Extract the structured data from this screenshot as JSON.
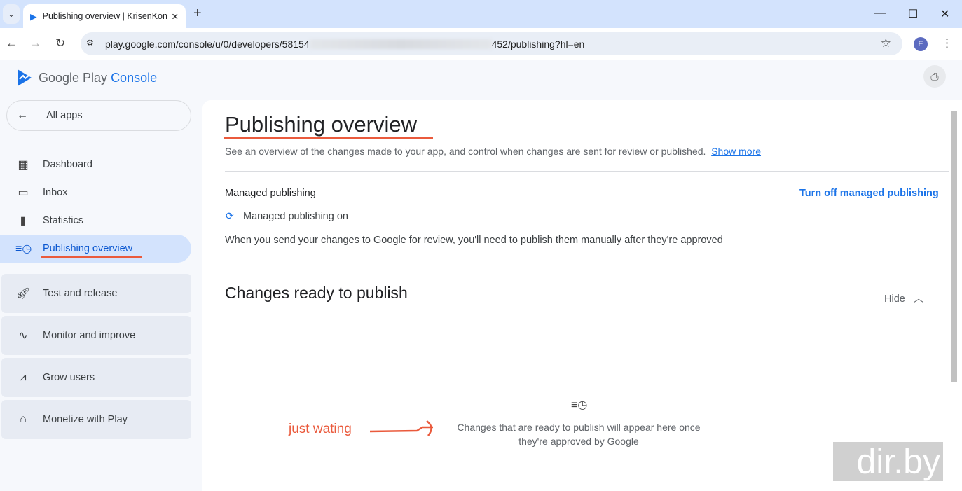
{
  "browser": {
    "tab_title": "Publishing overview | KrisenKon",
    "url_prefix": "play.google.com/console/u/0/developers/58154",
    "url_suffix": "452/publishing?hl=en",
    "avatar_letter": "E"
  },
  "logo": {
    "google_play": "Google Play",
    "console": "Console"
  },
  "sidebar": {
    "all_apps": "All apps",
    "items": [
      {
        "label": "Dashboard"
      },
      {
        "label": "Inbox"
      },
      {
        "label": "Statistics"
      },
      {
        "label": "Publishing overview"
      }
    ],
    "groups": [
      {
        "label": "Test and release"
      },
      {
        "label": "Monitor and improve"
      },
      {
        "label": "Grow users"
      },
      {
        "label": "Monetize with Play"
      }
    ]
  },
  "main": {
    "title": "Publishing overview",
    "description": "See an overview of the changes made to your app, and control when changes are sent for review or published.",
    "show_more": "Show more",
    "managed_heading": "Managed publishing",
    "turn_off": "Turn off managed publishing",
    "managed_status": "Managed publishing on",
    "managed_desc": "When you send your changes to Google for review, you'll need to publish them manually after they're approved",
    "changes_heading": "Changes ready to publish",
    "hide": "Hide",
    "empty_line1": "Changes that are ready to publish will appear here once",
    "empty_line2": "they're approved by Google"
  },
  "annotation": {
    "text": "just wating",
    "color": "#ea5a3c"
  },
  "watermark": "dir.by"
}
